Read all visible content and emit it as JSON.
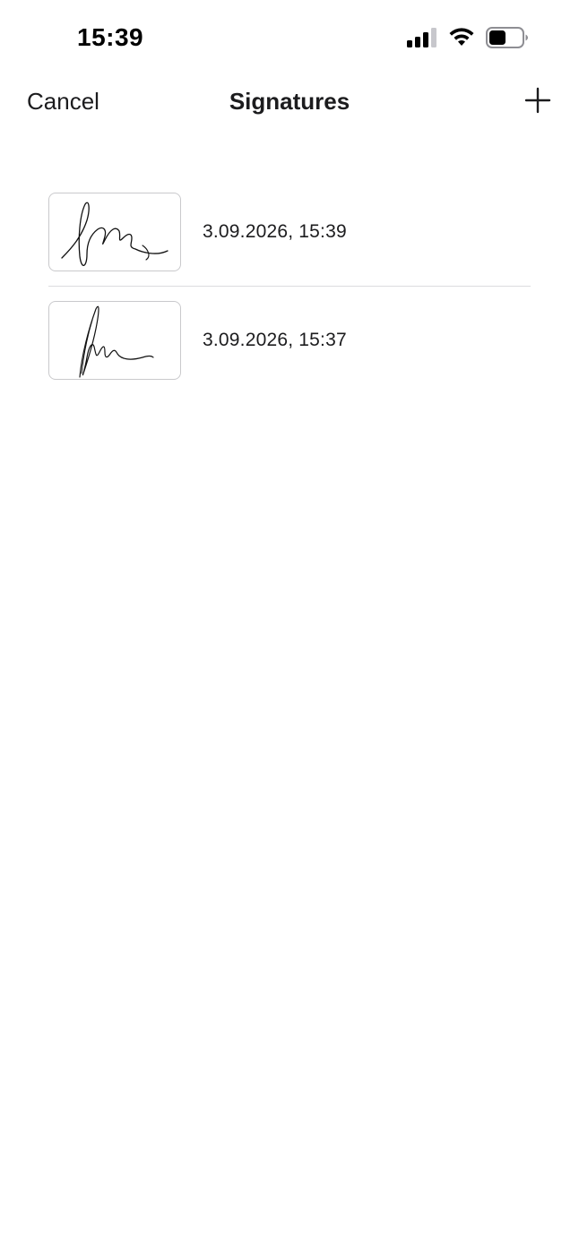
{
  "status_bar": {
    "time": "15:39",
    "icons": [
      "cellular-signal-icon",
      "wifi-icon",
      "battery-icon"
    ]
  },
  "nav": {
    "cancel_label": "Cancel",
    "title": "Signatures",
    "add_icon": "plus-icon"
  },
  "signatures": [
    {
      "date": "3.09.2026, 15:39"
    },
    {
      "date": "3.09.2026, 15:37"
    }
  ],
  "colors": {
    "text": "#1c1c1e",
    "divider": "#dcdcde",
    "thumb_border": "#c9c9cc"
  }
}
